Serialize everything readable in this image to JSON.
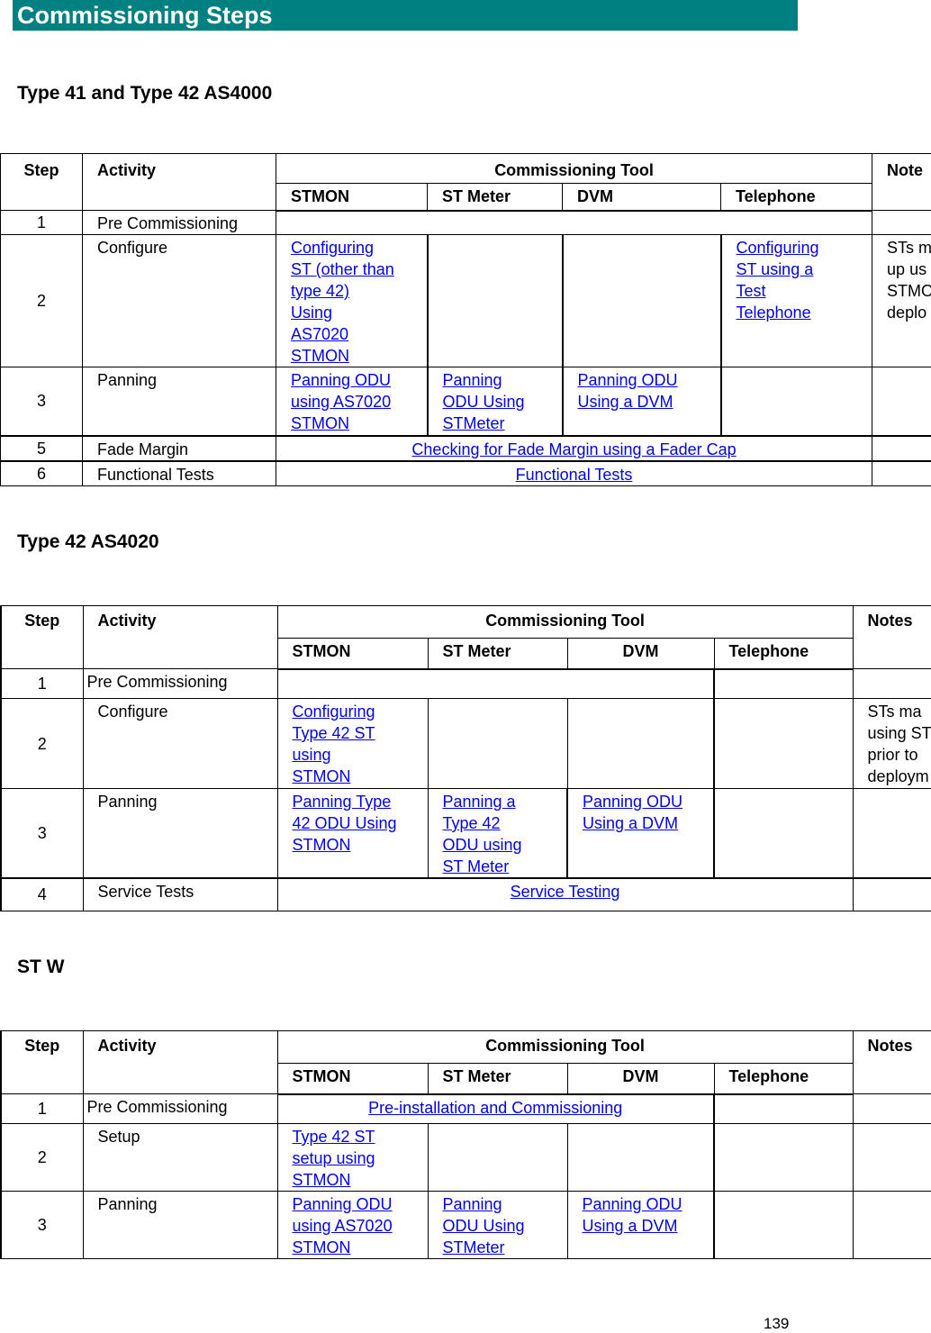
{
  "banner": {
    "title": "Commissioning Steps",
    "color": "#008080"
  },
  "sections": [
    {
      "title": "Type 41 and Type 42 AS4000",
      "headers": {
        "step": "Step",
        "activity": "Activity",
        "tool": "Commissioning Tool",
        "notes": "Note",
        "stmon": "STMON",
        "st_meter": "ST Meter",
        "dvm": "DVM",
        "telephone": "Telephone"
      },
      "rows": [
        {
          "step": "1",
          "activity": "Pre Commissioning"
        },
        {
          "step": "2",
          "activity": "Configure",
          "stmon": [
            "Configuring",
            "ST (other than",
            "type 42)",
            "Using",
            "AS7020",
            "STMON"
          ],
          "telephone": [
            "Configuring",
            "ST using a",
            "Test",
            "Telephone"
          ],
          "notes": [
            "STs m",
            "up us",
            "STMO",
            "deplo"
          ]
        },
        {
          "step": "3",
          "activity": "Panning",
          "stmon": [
            "Panning ODU",
            "using AS7020",
            "STMON"
          ],
          "st_meter": [
            "Panning",
            "ODU Using",
            "STMeter"
          ],
          "dvm": [
            "Panning ODU",
            "Using a DVM"
          ]
        },
        {
          "step": "5",
          "activity": "Fade Margin",
          "span_link": "Checking for Fade Margin using a Fader Cap"
        },
        {
          "step": "6",
          "activity": "Functional Tests",
          "span_link": "Functional Tests"
        }
      ]
    },
    {
      "title": "Type 42 AS4020",
      "headers": {
        "step": "Step",
        "activity": "Activity",
        "tool": "Commissioning Tool",
        "notes": "Notes",
        "stmon": "STMON",
        "st_meter": "ST Meter",
        "dvm": "DVM",
        "telephone": "Telephone"
      },
      "rows": [
        {
          "step": "1",
          "activity": "Pre Commissioning"
        },
        {
          "step": "2",
          "activity": "Configure",
          "stmon": [
            "Configuring",
            "Type 42 ST",
            "using",
            "STMON"
          ],
          "notes": [
            "STs ma",
            "using ST",
            "prior to",
            "deploym"
          ]
        },
        {
          "step": "3",
          "activity": "Panning",
          "stmon": [
            "Panning Type",
            "42 ODU Using",
            "STMON"
          ],
          "st_meter": [
            "Panning a",
            "Type 42",
            "ODU using",
            "ST Meter"
          ],
          "dvm": [
            "Panning ODU",
            "Using a DVM"
          ]
        },
        {
          "step": "4",
          "activity": "Service Tests",
          "span_link": "Service Testing"
        }
      ]
    },
    {
      "title": "ST W",
      "headers": {
        "step": "Step",
        "activity": "Activity",
        "tool": "Commissioning Tool",
        "notes": "Notes",
        "stmon": "STMON",
        "st_meter": "ST Meter",
        "dvm": "DVM",
        "telephone": "Telephone"
      },
      "rows": [
        {
          "step": "1",
          "activity": "Pre Commissioning",
          "span_link": "Pre-installation and Commissioning"
        },
        {
          "step": "2",
          "activity": "Setup",
          "stmon": [
            "Type 42 ST",
            "setup using",
            "STMON"
          ]
        },
        {
          "step": "3",
          "activity": "Panning",
          "stmon": [
            "Panning ODU",
            "using AS7020",
            "STMON"
          ],
          "st_meter": [
            "Panning",
            "ODU Using",
            "STMeter"
          ],
          "dvm": [
            "Panning ODU",
            "Using a DVM"
          ]
        }
      ]
    }
  ],
  "page_number": "139"
}
